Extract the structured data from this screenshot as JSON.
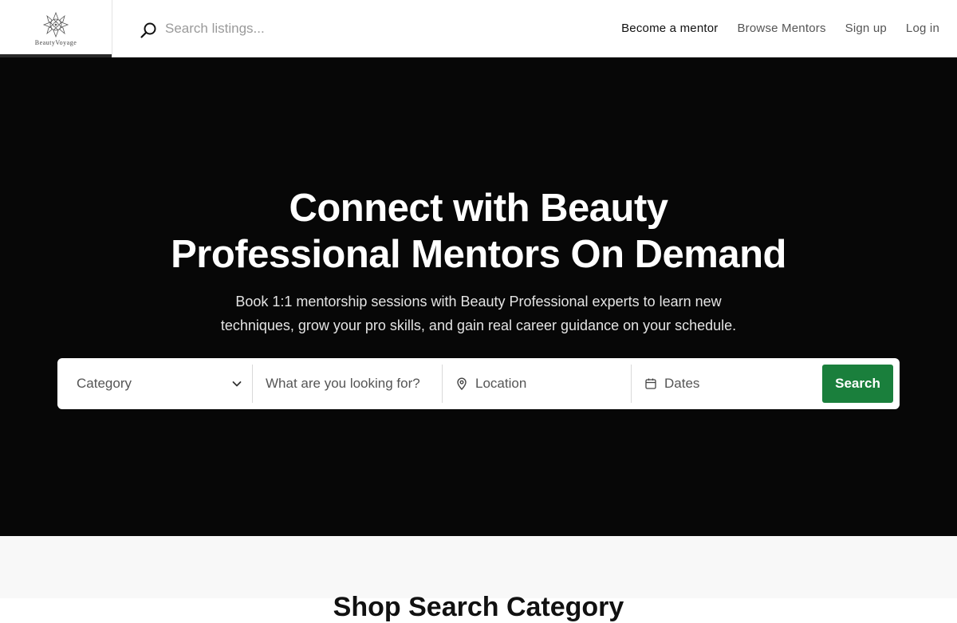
{
  "header": {
    "logo_text": "BeautyVoyage",
    "search_placeholder": "Search listings...",
    "nav": {
      "become_mentor": "Become a mentor",
      "browse_mentors": "Browse Mentors",
      "sign_up": "Sign up",
      "log_in": "Log in"
    }
  },
  "hero": {
    "title_line1": "Connect with Beauty",
    "title_line2": "Professional Mentors On Demand",
    "subtitle_line1": "Book 1:1 mentorship sessions with Beauty Professional experts to learn new",
    "subtitle_line2": "techniques, grow your pro skills, and gain real career guidance on your schedule.",
    "search": {
      "category_label": "Category",
      "keyword_placeholder": "What are you looking for?",
      "location_placeholder": "Location",
      "dates_placeholder": "Dates",
      "button_label": "Search"
    }
  },
  "section": {
    "title": "Shop Search Category"
  },
  "colors": {
    "hero_bg": "#070707",
    "accent_green": "#1a7f3c"
  }
}
